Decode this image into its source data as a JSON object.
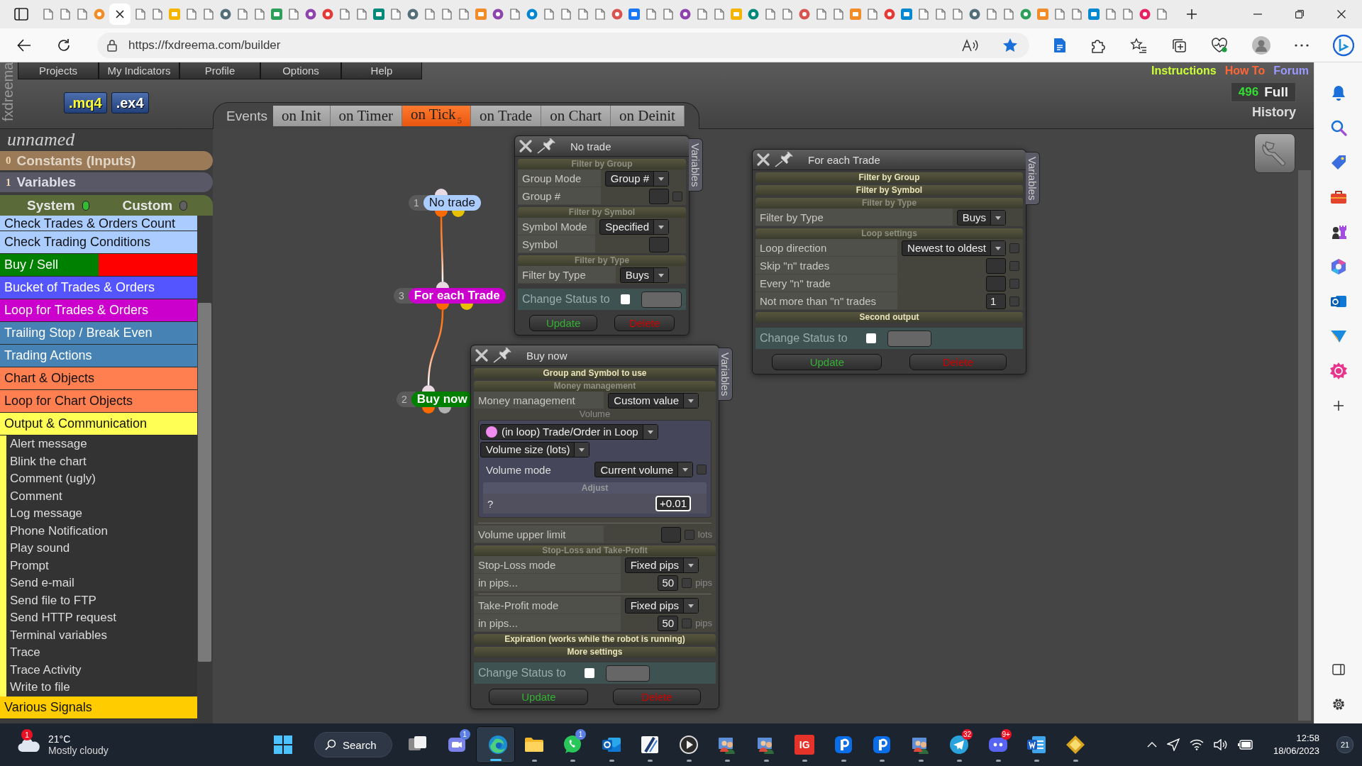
{
  "browser": {
    "tabs": [
      {
        "selected": false
      },
      {
        "selected": false
      },
      {
        "selected": false
      },
      {
        "selected": false
      },
      {
        "selected": true
      },
      {
        "selected": false
      },
      {
        "selected": false
      },
      {
        "selected": false
      },
      {
        "selected": false
      },
      {
        "selected": false
      },
      {
        "selected": false
      },
      {
        "selected": false
      },
      {
        "selected": false
      },
      {
        "selected": false
      },
      {
        "selected": false
      },
      {
        "selected": false
      },
      {
        "selected": false
      },
      {
        "selected": false
      },
      {
        "selected": false
      },
      {
        "selected": false
      },
      {
        "selected": false
      },
      {
        "selected": false
      },
      {
        "selected": false
      },
      {
        "selected": false
      },
      {
        "selected": false
      },
      {
        "selected": false
      },
      {
        "selected": false
      },
      {
        "selected": false
      },
      {
        "selected": false
      },
      {
        "selected": false
      },
      {
        "selected": false
      },
      {
        "selected": false
      },
      {
        "selected": false
      },
      {
        "selected": false
      },
      {
        "selected": false
      },
      {
        "selected": false
      },
      {
        "selected": false
      },
      {
        "selected": false
      },
      {
        "selected": false
      },
      {
        "selected": false
      },
      {
        "selected": false
      },
      {
        "selected": false
      },
      {
        "selected": false
      },
      {
        "selected": false
      },
      {
        "selected": false
      },
      {
        "selected": false
      },
      {
        "selected": false
      },
      {
        "selected": false
      },
      {
        "selected": false
      },
      {
        "selected": false
      },
      {
        "selected": false
      },
      {
        "selected": false
      },
      {
        "selected": false
      },
      {
        "selected": false
      },
      {
        "selected": false
      },
      {
        "selected": false
      },
      {
        "selected": false
      },
      {
        "selected": false
      },
      {
        "selected": false
      },
      {
        "selected": false
      },
      {
        "selected": false
      },
      {
        "selected": false
      },
      {
        "selected": false
      },
      {
        "selected": false
      },
      {
        "selected": false
      },
      {
        "selected": false
      }
    ],
    "url": "https://fxdreema.com/builder"
  },
  "header": {
    "logo": "fxdreema",
    "menu": [
      "Projects",
      "My Indicators",
      "Profile",
      "Options",
      "Help"
    ],
    "links": [
      {
        "label": "Instructions",
        "color": "#ccff33"
      },
      {
        "label": "How To",
        "color": "#ff6633"
      },
      {
        "label": "Forum",
        "color": "#9999ff"
      }
    ],
    "exports": [
      ".mq4",
      ".ex4"
    ],
    "counter": "496",
    "plan": "Full",
    "history": "History"
  },
  "events": {
    "label": "Events",
    "tabs": [
      {
        "label": "on Init",
        "selected": false
      },
      {
        "label": "on Timer",
        "selected": false
      },
      {
        "label": "on Tick",
        "count": "5",
        "selected": true
      },
      {
        "label": "on Trade",
        "selected": false
      },
      {
        "label": "on Chart",
        "selected": false
      },
      {
        "label": "on Deinit",
        "selected": false
      }
    ]
  },
  "sidebar": {
    "project": "unnamed",
    "constants": {
      "count": "0",
      "label": "Constants (Inputs)"
    },
    "variables": {
      "count": "1",
      "label": "Variables"
    },
    "toggles": [
      {
        "label": "System",
        "on": true
      },
      {
        "label": "Custom",
        "on": false
      }
    ],
    "categories": [
      {
        "label": "Check Trades & Orders Count",
        "color": "#aaccff"
      },
      {
        "label": "Check Trading Conditions",
        "color": "#aaccff"
      },
      {
        "label": "Buy / Sell",
        "segments": [
          {
            "color": "#008000"
          },
          {
            "color": "#ff0000"
          }
        ]
      },
      {
        "label": "Bucket of Trades & Orders",
        "color": "#5555ff"
      },
      {
        "label": "Loop for Trades & Orders",
        "color": "#cc00cc"
      },
      {
        "label": "Trailing Stop / Break Even",
        "color": "#4682b4"
      },
      {
        "label": "Trading Actions",
        "color": "#4682b4"
      },
      {
        "label": "Chart & Objects",
        "color": "#ff7f50"
      },
      {
        "label": "Loop for Chart Objects",
        "color": "#ff7f50"
      },
      {
        "label": "Output & Communication",
        "color": "#ffff55",
        "children": [
          "Alert message",
          "Blink the chart",
          "Comment (ugly)",
          "Comment",
          "Log message",
          "Phone Notification",
          "Play sound",
          "Prompt",
          "Send e-mail",
          "Send file to FTP",
          "Send HTTP request",
          "Terminal variables",
          "Trace",
          "Trace Activity",
          "Write to file"
        ]
      },
      {
        "label": "Various Signals",
        "color": "#ffcc00"
      }
    ]
  },
  "nodes": [
    {
      "number": "1",
      "label": "No trade",
      "color": "#aaccff",
      "second_output": true
    },
    {
      "number": "3",
      "label": "For each Trade",
      "color": "#cc00cc",
      "second_output": true
    },
    {
      "number": "2",
      "label": "Buy now",
      "color": "#008000",
      "second_output": false
    }
  ],
  "dialogs": [
    {
      "title": "No trade",
      "side_tab": "Variables",
      "blocks": [
        {
          "heading": "Filter by Group",
          "expanded": true,
          "rows": [
            {
              "kind": "select",
              "label": "Group Mode",
              "value": "Group #"
            },
            {
              "kind": "number",
              "label": "Group #",
              "checked": false
            }
          ]
        },
        {
          "heading": "Filter by Symbol",
          "expanded": true,
          "rows": [
            {
              "kind": "select",
              "label": "Symbol Mode",
              "value": "Specified"
            },
            {
              "kind": "number",
              "label": "Symbol"
            }
          ]
        },
        {
          "heading": "Filter by Type",
          "expanded": true,
          "rows": [
            {
              "kind": "select",
              "label": "Filter by Type",
              "value": "Buys"
            }
          ]
        }
      ],
      "status": {
        "label": "Change Status to",
        "checked": false
      },
      "buttons": [
        {
          "kind": "update",
          "label": "Update"
        },
        {
          "kind": "delete",
          "label": "Delete"
        }
      ]
    },
    {
      "title": "For each Trade",
      "side_tab": "Variables",
      "blocks": [
        {
          "heading": "Filter by Group",
          "expanded": false
        },
        {
          "heading": "Filter by Symbol",
          "expanded": false
        },
        {
          "heading": "Filter by Type",
          "expanded": true,
          "rows": [
            {
              "kind": "select",
              "label": "Filter by Type",
              "value": "Buys"
            }
          ]
        },
        {
          "heading": "Loop settings",
          "expanded": true,
          "rows": [
            {
              "kind": "select",
              "label": "Loop direction",
              "value": "Newest to oldest",
              "checked": false
            },
            {
              "kind": "number",
              "label": "Skip \"n\" trades",
              "checked": false
            },
            {
              "kind": "number",
              "label": "Every \"n\" trade",
              "checked": false
            },
            {
              "kind": "number",
              "label": "Not more than \"n\" trades",
              "value": "1",
              "checked": false
            }
          ]
        },
        {
          "heading": "Second output",
          "expanded": false
        }
      ],
      "status": {
        "label": "Change Status to",
        "checked": false
      },
      "buttons": [
        {
          "kind": "update",
          "label": "Update"
        },
        {
          "kind": "delete",
          "label": "Delete"
        }
      ]
    },
    {
      "title": "Buy now",
      "side_tab": "Variables",
      "blocks": [
        {
          "heading": "Group and Symbol to use",
          "expanded": false
        },
        {
          "heading": "Money management",
          "expanded": true,
          "rows": [
            {
              "kind": "select",
              "label": "Money management",
              "value": "Custom value"
            },
            {
              "kind": "group",
              "caption": "Volume",
              "rows": [
                {
                  "kind": "picker",
                  "value": "(in loop) Trade/Order in Loop"
                },
                {
                  "kind": "dropdown",
                  "value": "Volume size (lots)"
                },
                {
                  "kind": "select",
                  "label": "Volume mode",
                  "value": "Current volume",
                  "checked": false
                },
                {
                  "kind": "subheading",
                  "label": "Adjust"
                },
                {
                  "kind": "field",
                  "label": "?",
                  "value": "+0.01",
                  "focused": true
                }
              ]
            },
            {
              "kind": "divider"
            },
            {
              "kind": "number",
              "label": "Volume upper limit",
              "checked": false,
              "unit": "lots"
            }
          ]
        },
        {
          "heading": "Stop-Loss and Take-Profit",
          "expanded": true,
          "rows": [
            {
              "kind": "select",
              "label": "Stop-Loss mode",
              "value": "Fixed pips"
            },
            {
              "kind": "number",
              "label": "in pips...",
              "value": "50",
              "checked": false,
              "unit": "pips"
            },
            {
              "kind": "divider"
            },
            {
              "kind": "select",
              "label": "Take-Profit mode",
              "value": "Fixed pips"
            },
            {
              "kind": "number",
              "label": "in pips...",
              "value": "50",
              "checked": false,
              "unit": "pips"
            }
          ]
        },
        {
          "heading": "Expiration (works while the robot is running)",
          "expanded": false
        },
        {
          "heading": "More settings",
          "expanded": false
        }
      ],
      "status": {
        "label": "Change Status to",
        "checked": false
      },
      "buttons": [
        {
          "kind": "update",
          "label": "Update"
        },
        {
          "kind": "delete",
          "label": "Delete"
        }
      ]
    }
  ],
  "taskbar": {
    "weather": {
      "alerts": "1",
      "temperature": "21°C",
      "condition": "Mostly cloudy"
    },
    "search": {
      "placeholder": "Search"
    },
    "apps": [
      {
        "kind": "taskview",
        "running": false,
        "selected": false
      },
      {
        "kind": "chat",
        "badge": "1",
        "color": "#5b7ee5",
        "running": false,
        "selected": false
      },
      {
        "kind": "browser",
        "running": true,
        "selected": true
      },
      {
        "kind": "folder",
        "running": true,
        "selected": false
      },
      {
        "kind": "whatsapp",
        "badge": "1",
        "color": "#5b7ee5",
        "running": true,
        "selected": false
      },
      {
        "kind": "mail",
        "running": true,
        "selected": false
      },
      {
        "kind": "stripes",
        "running": true,
        "selected": false
      },
      {
        "kind": "player",
        "running": true,
        "selected": false
      },
      {
        "kind": "people",
        "running": true,
        "selected": false
      },
      {
        "kind": "people",
        "running": true,
        "selected": false
      },
      {
        "kind": "ig",
        "label": "IG",
        "running": true,
        "selected": false
      },
      {
        "kind": "pcoin",
        "running": true,
        "selected": false
      },
      {
        "kind": "pcoin",
        "running": true,
        "selected": false
      },
      {
        "kind": "people",
        "running": true,
        "selected": false
      },
      {
        "kind": "telegram",
        "badge": "32",
        "color": "#e81123",
        "running": true,
        "selected": false
      },
      {
        "kind": "discord",
        "badge": "9+",
        "color": "#e81123",
        "running": true,
        "selected": false
      },
      {
        "kind": "word",
        "running": true,
        "selected": false
      },
      {
        "kind": "diamond",
        "running": true,
        "selected": false
      }
    ],
    "clock": {
      "time": "12:58",
      "date": "18/06/2023"
    },
    "notifications": "21"
  }
}
